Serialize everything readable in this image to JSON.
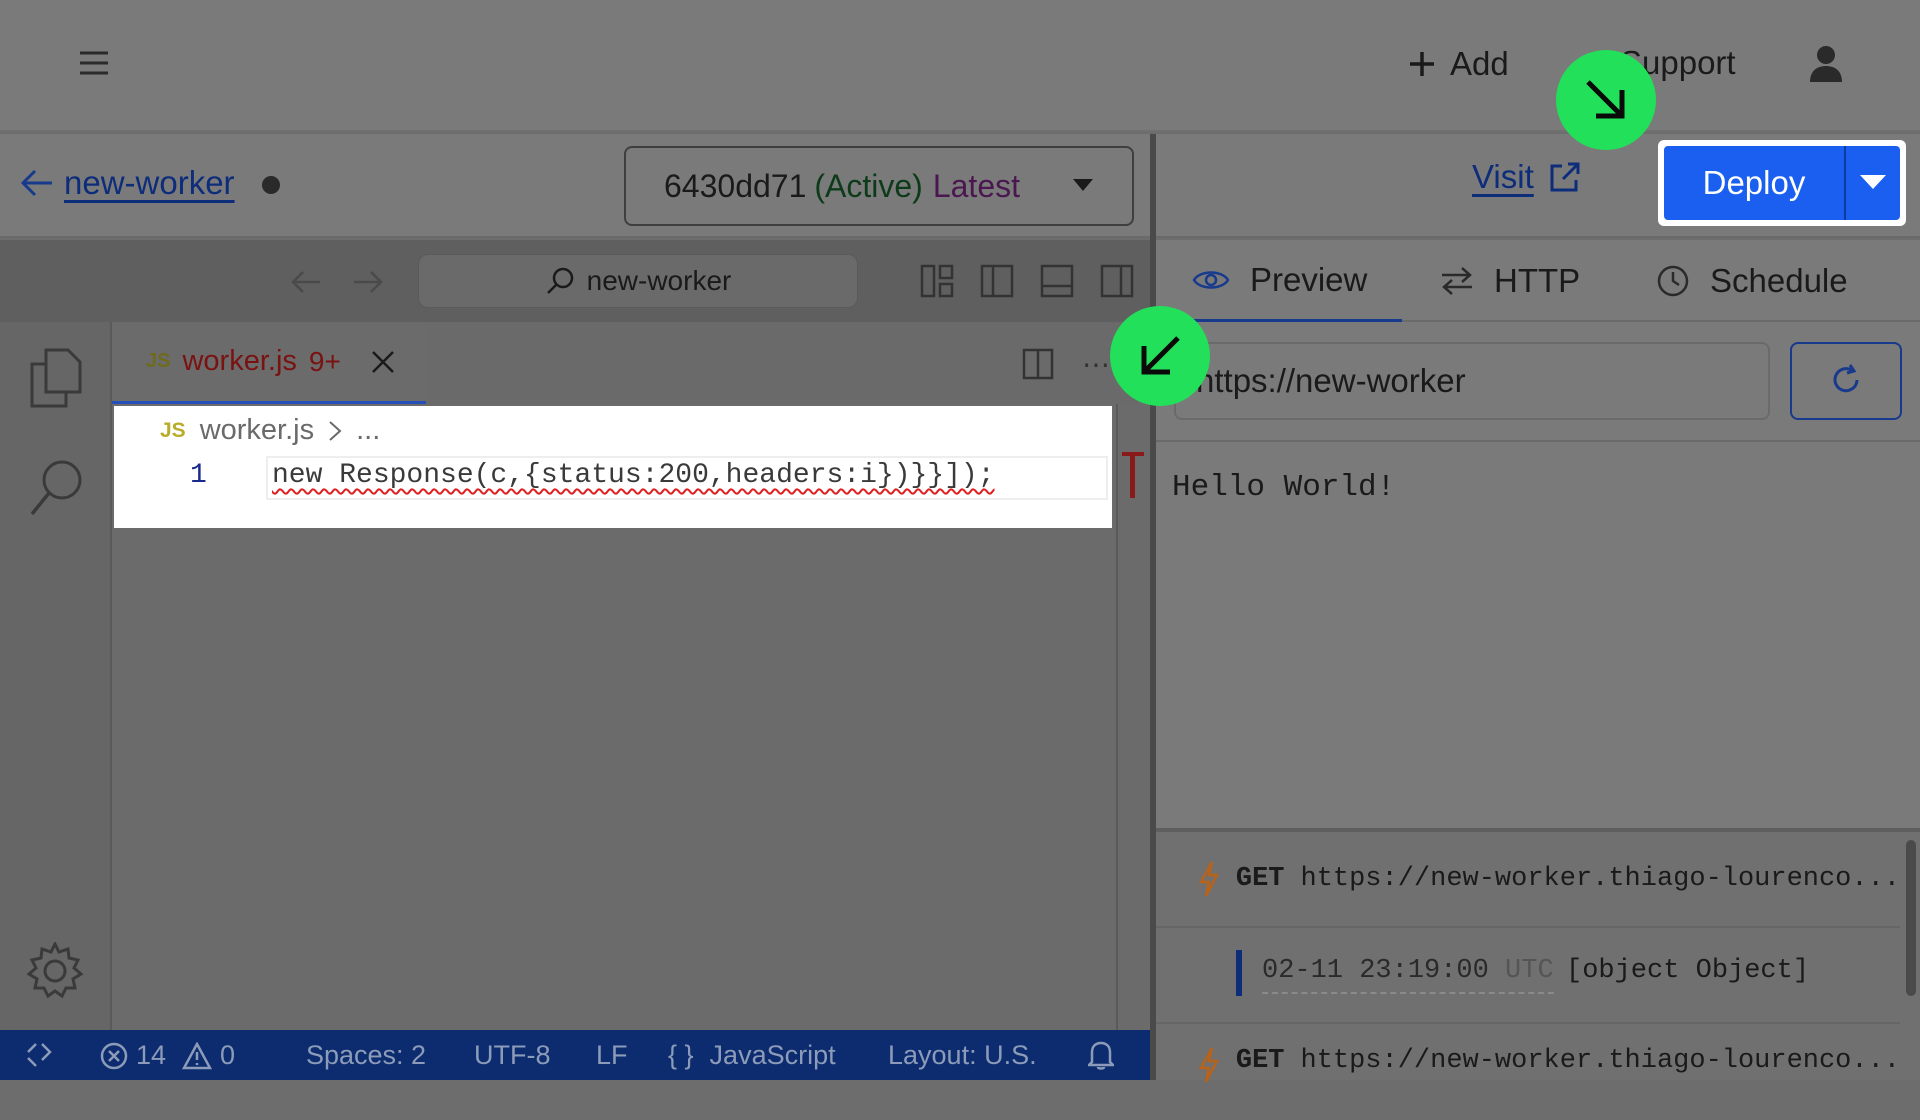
{
  "header": {
    "add_label": "Add",
    "support_label": "Support"
  },
  "worker": {
    "name": "new-worker",
    "version_id": "6430dd71",
    "version_status": "(Active)",
    "version_tag": "Latest"
  },
  "actions": {
    "visit_label": "Visit",
    "deploy_label": "Deploy"
  },
  "toolbar": {
    "search_text": "new-worker"
  },
  "editor": {
    "tab_lang": "JS",
    "tab_filename": "worker.js",
    "tab_problems": "9+",
    "breadcrumb_lang": "JS",
    "breadcrumb_file": "worker.js",
    "breadcrumb_more": "...",
    "line_number": "1",
    "code_line": "new Response(c,{status:200,headers:i})}}]);"
  },
  "statusbar": {
    "errors": "14",
    "warnings": "0",
    "spaces": "Spaces: 2",
    "encoding": "UTF-8",
    "eol": "LF",
    "language": "JavaScript",
    "layout": "Layout: U.S."
  },
  "preview": {
    "tabs": [
      "Preview",
      "HTTP",
      "Schedule"
    ],
    "url": "https://new-worker",
    "output": "Hello World!"
  },
  "logs": {
    "entries": [
      {
        "method": "GET",
        "url": "https://new-worker.thiago-lourenco..."
      },
      {
        "date": "02-11 23:19:00",
        "tz": "UTC",
        "message": "[object Object]"
      },
      {
        "method": "GET",
        "url": "https://new-worker.thiago-lourenco..."
      }
    ]
  },
  "colors": {
    "accent_blue": "#1a5ff0",
    "status_bar": "#0d2c6f",
    "highlight_green": "#22e05a"
  }
}
